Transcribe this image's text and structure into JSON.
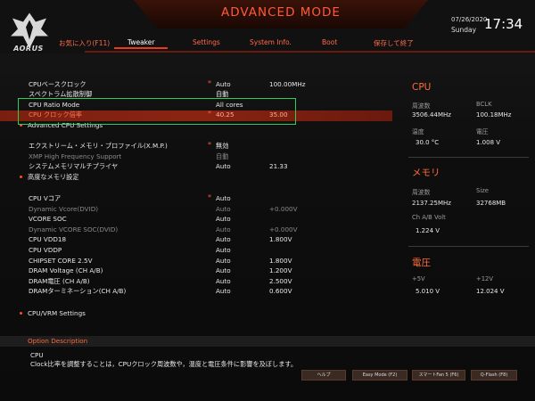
{
  "header": {
    "title": "ADVANCED MODE",
    "logo_text": "AORUS",
    "date": "07/26/2020",
    "day": "Sunday",
    "time": "17:34",
    "tabs": [
      {
        "label": "お気に入り(F11)"
      },
      {
        "label": "Tweaker"
      },
      {
        "label": "Settings"
      },
      {
        "label": "System Info."
      },
      {
        "label": "Boot"
      },
      {
        "label": "保存して終了"
      }
    ]
  },
  "settings": [
    {
      "label": "CPUベースクロック",
      "star": "*",
      "value": "Auto",
      "value2": "100.00MHz"
    },
    {
      "label": "スペクトラム拡散制御",
      "value": "自動"
    },
    {
      "label": "CPU Ratio Mode",
      "value": "All cores"
    },
    {
      "label": "CPU クロック倍率",
      "star": "*",
      "value": "40.25",
      "value2": "35.00"
    },
    {
      "label": "Advanced CPU Settings"
    },
    {
      "label": "エクストリーム・メモリ・プロファイル(X.M.P.)",
      "star": "*",
      "value": "無効"
    },
    {
      "label": "XMP High Frequency Support",
      "value": "自動"
    },
    {
      "label": "システムメモリマルチプライヤ",
      "value": "Auto",
      "value2": "21.33"
    },
    {
      "label": "高度なメモリ設定"
    },
    {
      "label": "CPU Vコア",
      "star": "*",
      "value": "Auto"
    },
    {
      "label": "Dynamic Vcore(DVID)",
      "value": "Auto",
      "value2": "+0.000V"
    },
    {
      "label": "VCORE SOC",
      "value": "Auto"
    },
    {
      "label": "Dynamic VCORE SOC(DVID)",
      "value": "Auto",
      "value2": "+0.000V"
    },
    {
      "label": "CPU VDD18",
      "value": "Auto",
      "value2": "1.800V"
    },
    {
      "label": "CPU VDDP",
      "value": "Auto"
    },
    {
      "label": "CHIPSET CORE 2.5V",
      "value": "Auto",
      "value2": "1.800V"
    },
    {
      "label": "DRAM Voltage    (CH A/B)",
      "value": "Auto",
      "value2": "1.200V"
    },
    {
      "label": "DRAM電圧          (CH A/B)",
      "value": "Auto",
      "value2": "2.500V"
    },
    {
      "label": "DRAMターミネーション(CH A/B)",
      "value": "Auto",
      "value2": "0.600V"
    },
    {
      "label": "CPU/VRM Settings"
    }
  ],
  "panel": {
    "cpu": {
      "heading": "CPU",
      "freq_label": "周波数",
      "freq_value": "3506.44MHz",
      "bclk_label": "BCLK",
      "bclk_value": "100.18MHz",
      "temp_label": "温度",
      "temp_value": "30.0 °C",
      "volt_label": "電圧",
      "volt_value": "1.008 V"
    },
    "memory": {
      "heading": "メモリ",
      "freq_label": "周波数",
      "freq_value": "2137.25MHz",
      "size_label": "Size",
      "size_value": "32768MB",
      "volt_label": "Ch A/B Volt",
      "volt_value": "1.224 V"
    },
    "voltage": {
      "heading": "電圧",
      "p5_label": "+5V",
      "p5_value": "5.010 V",
      "p12_label": "+12V",
      "p12_value": "12.024 V"
    }
  },
  "option_description": {
    "title": "Option Description",
    "line1": "CPU",
    "line2": "Clock比率を調整することは，CPUクロック周波数や，温度と電圧条件に影響を及ぼします。"
  },
  "footer_buttons": [
    {
      "label": "ヘルプ"
    },
    {
      "label": "Easy Mode (F2)"
    },
    {
      "label": "スマートFan 5 (F6)"
    },
    {
      "label": "Q-Flash (F8)"
    }
  ],
  "colors": {
    "accent": "#ff5a3c",
    "selection": "#8a2412",
    "highlight_box": "#2ecc5a"
  }
}
